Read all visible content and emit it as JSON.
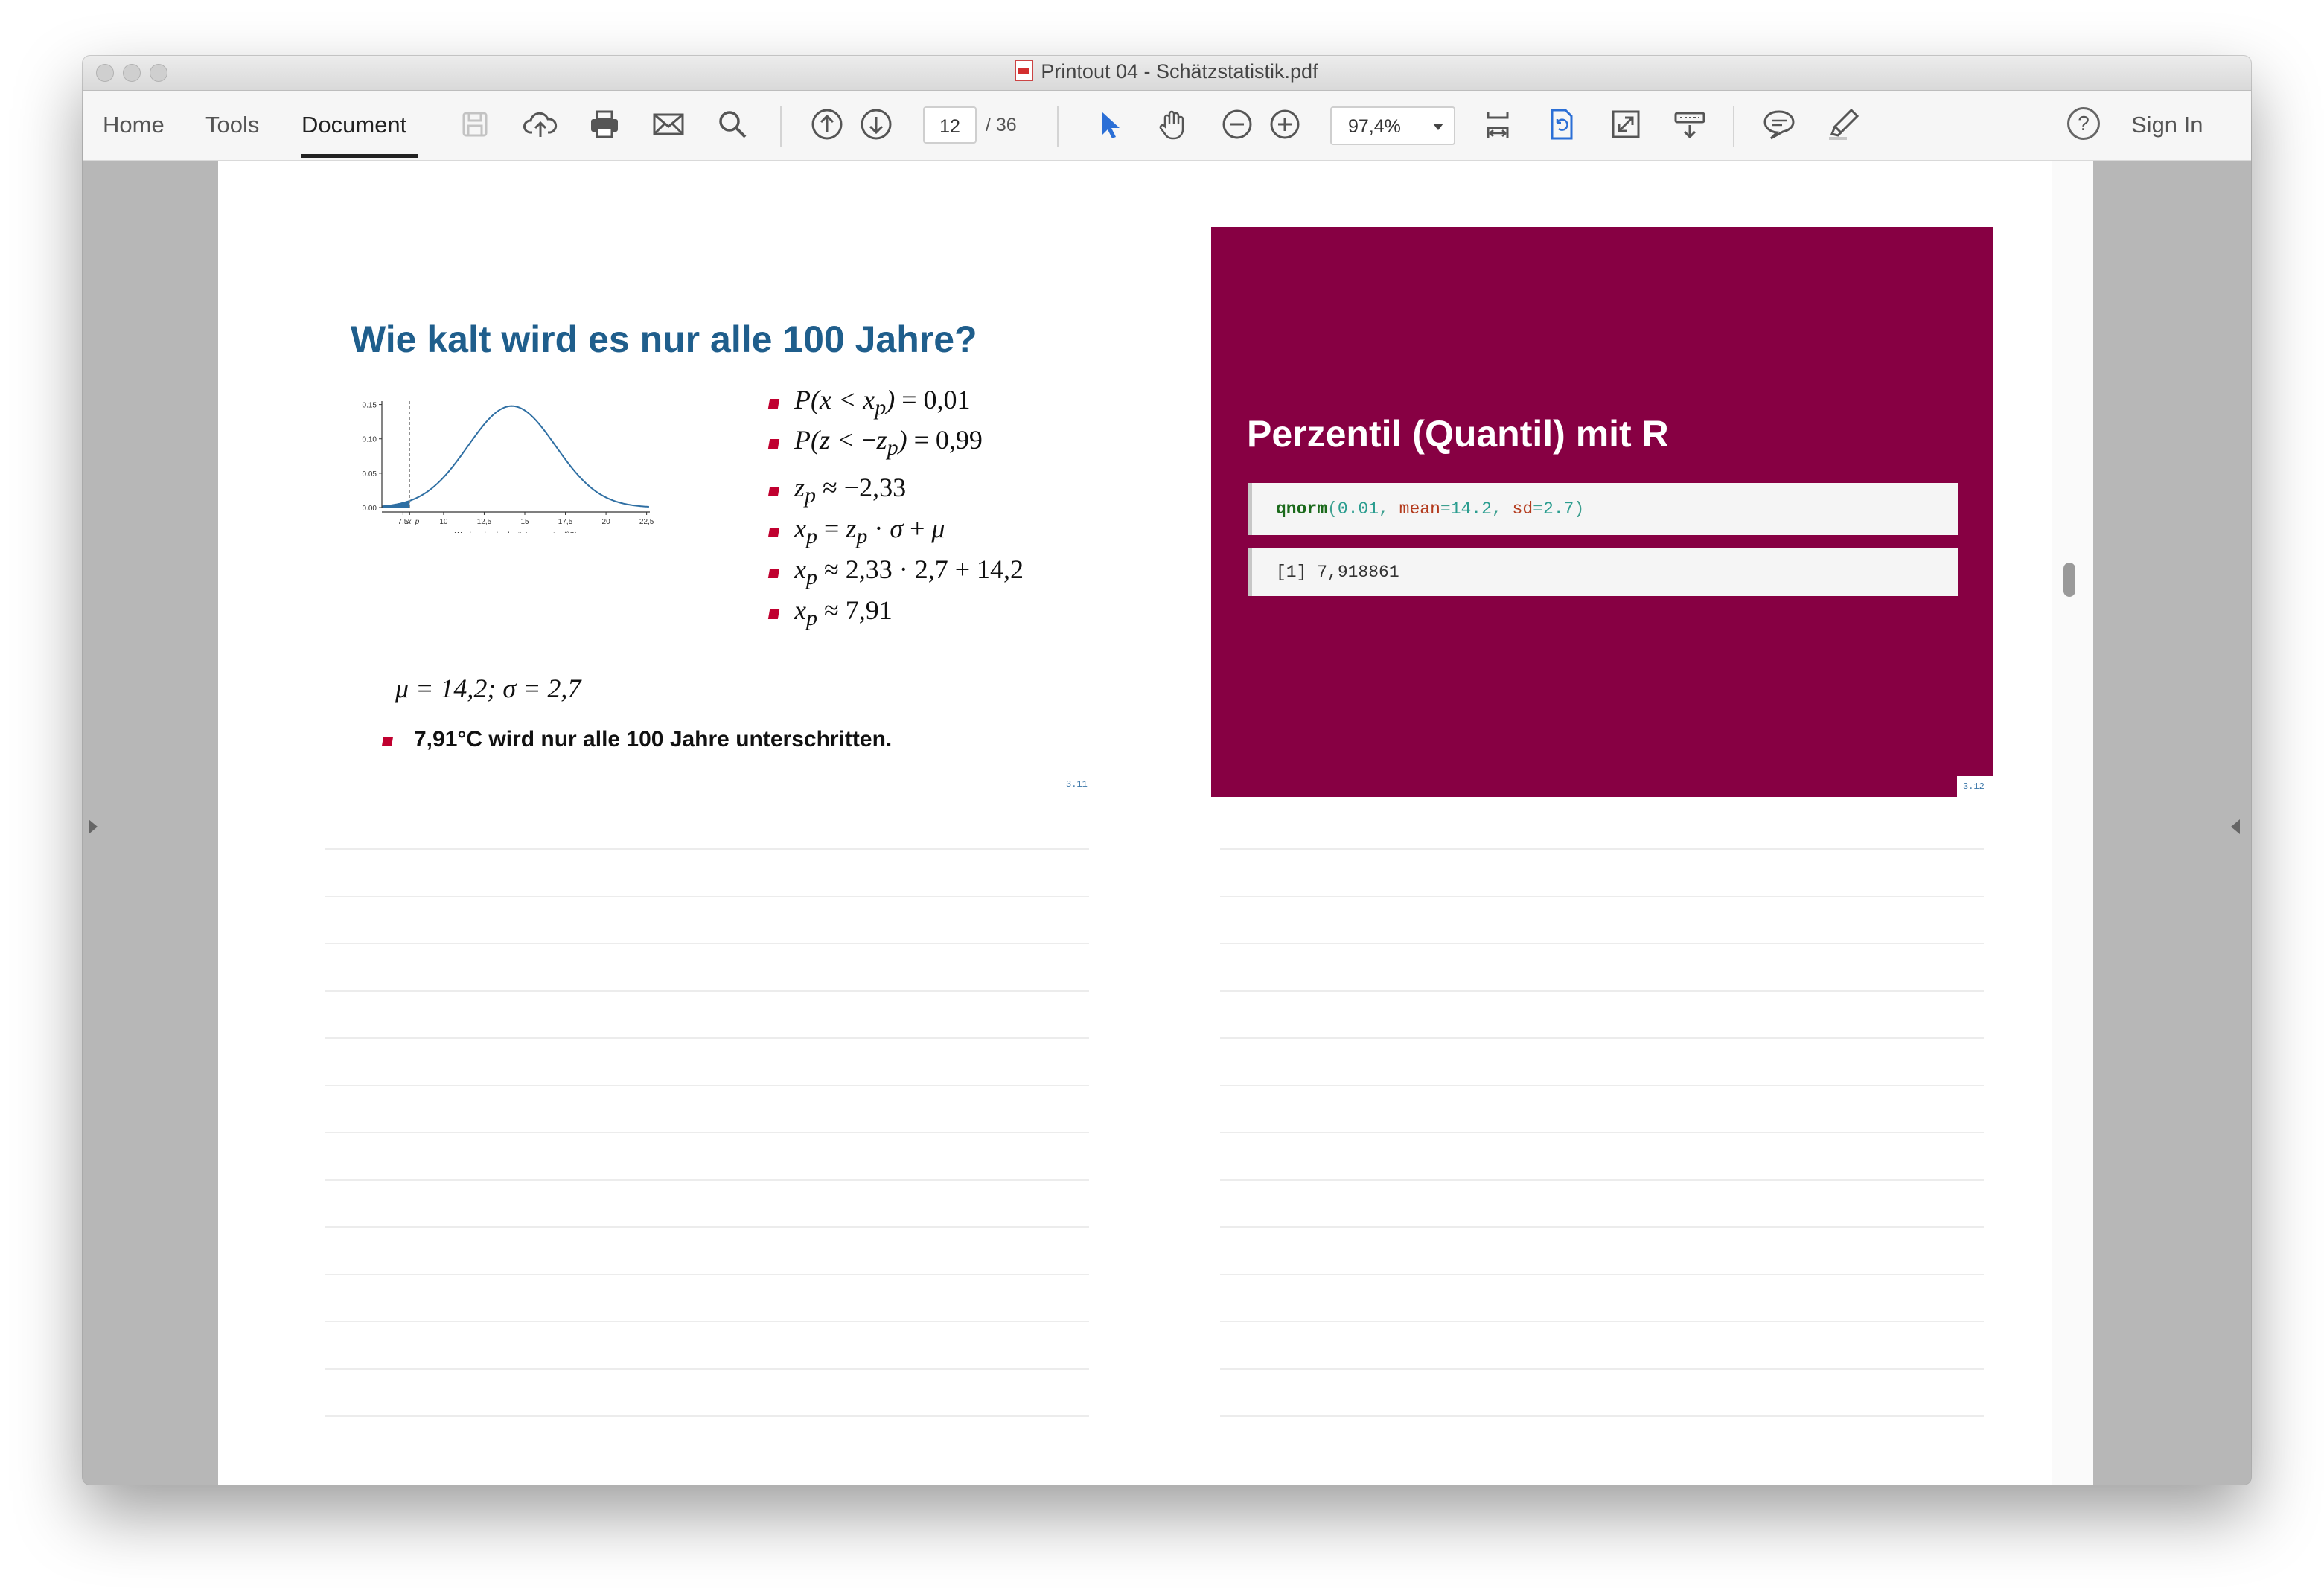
{
  "window": {
    "title": "Printout 04 - Schätzstatistik.pdf"
  },
  "toolbar": {
    "tabs": [
      {
        "label": "Home"
      },
      {
        "label": "Tools"
      },
      {
        "label": "Document"
      }
    ],
    "active_tab": "Document",
    "page_current": "12",
    "page_total": "/ 36",
    "zoom": "97,4%",
    "sign_in": "Sign In",
    "icons": [
      "save-icon",
      "upload-cloud-icon",
      "print-icon",
      "mail-icon",
      "search-icon",
      "page-up-icon",
      "page-down-icon",
      "select-arrow-icon",
      "hand-icon",
      "zoom-out-icon",
      "zoom-in-icon",
      "fit-page-icon",
      "rotate-icon",
      "fullscreen-icon",
      "read-mode-icon",
      "comment-icon",
      "highlight-icon",
      "help-icon"
    ]
  },
  "slide_left": {
    "title": "Wie kalt wird es nur alle 100 Jahre?",
    "equations": [
      "P(x < x_p) = 0,01",
      "P(z < −z_p) = 0,99",
      "z_p ≈ −2,33",
      "x_p = z_p · σ + μ",
      "x_p ≈ 2,33 · 2,7 + 14,2",
      "x_p ≈ 7,91"
    ],
    "params": "μ = 14,2;     σ = 2,7",
    "conclusion": "7,91°C wird nur alle 100 Jahre unterschritten.",
    "slide_number": "3.11"
  },
  "chart_data": {
    "type": "area",
    "title": "",
    "xlabel": "Wochendurchschnittstemperatur (°C)",
    "ylabel": "",
    "x_ticks": [
      "7,5",
      "x_p",
      "10",
      "12,5",
      "15",
      "17,5",
      "20",
      "22,5"
    ],
    "y_ticks": [
      "0.00",
      "0.05",
      "0.10",
      "0.15"
    ],
    "xlim": [
      6.2,
      22.7
    ],
    "ylim": [
      0,
      0.155
    ],
    "distribution": {
      "mean": 14.2,
      "sd": 2.7
    },
    "shaded_below": 7.91,
    "marker_line_x": 7.91,
    "series": [
      {
        "color": "#2f6fa3",
        "fill": "#2f6fa3"
      }
    ]
  },
  "slide_right": {
    "title": "Perzentil (Quantil) mit R",
    "code": {
      "fn": "qnorm",
      "open": "(",
      "a1": "0.01",
      "sep1": ", ",
      "arg2": "mean",
      "eq2": "=",
      "v2": "14.2",
      "sep2": ", ",
      "arg3": "sd",
      "eq3": "=",
      "v3": "2.7",
      "close": ")"
    },
    "output": "[1] 7,918861",
    "slide_number": "3.12",
    "background": "#870043"
  }
}
